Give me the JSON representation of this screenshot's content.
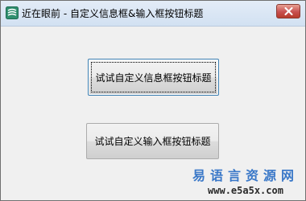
{
  "window": {
    "title": "近在眼前 - 自定义信息框&输入框按钮标题",
    "app_icon": "app-logo-icon",
    "close_icon": "close-icon"
  },
  "buttons": {
    "info_box_label": "试试自定义信息框按钮标题",
    "input_box_label": "试试自定义输入框按钮标题"
  },
  "watermark": {
    "brand": "易语言资源网",
    "url": "www.e5a5x.com"
  },
  "colors": {
    "accent": "#3c7fb1",
    "close_button": "#c75050",
    "watermark": "#3a78c8"
  }
}
